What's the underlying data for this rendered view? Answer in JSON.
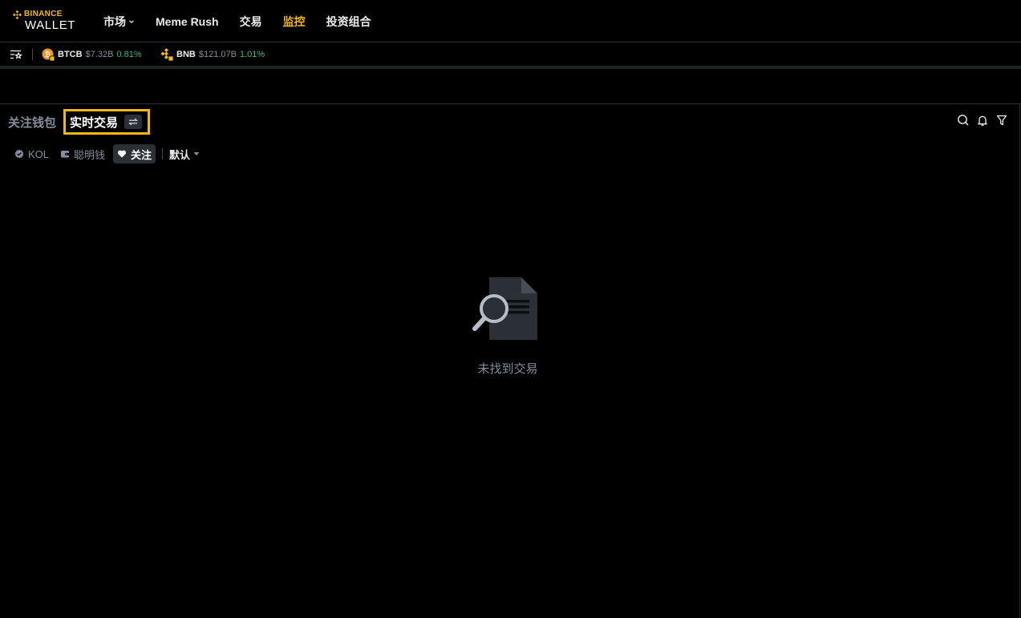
{
  "brand": {
    "name": "BINANCE",
    "product": "WALLET",
    "accent": "#f0b90b"
  },
  "nav": {
    "items": [
      {
        "label": "市场",
        "has_dropdown": true,
        "active": false
      },
      {
        "label": "Meme Rush",
        "active": false
      },
      {
        "label": "交易",
        "active": false
      },
      {
        "label": "监控",
        "active": true
      },
      {
        "label": "投资组合",
        "active": false
      }
    ]
  },
  "ticker": {
    "toggle_icon": "star-list-icon",
    "items": [
      {
        "symbol": "BTCB",
        "market_cap": "$7.32B",
        "change": "0.81%",
        "change_color": "#2ebd85",
        "icon": "btcb-coin-icon"
      },
      {
        "symbol": "BNB",
        "market_cap": "$121.07B",
        "change": "1.01%",
        "change_color": "#2ebd85",
        "icon": "bnb-coin-icon"
      }
    ]
  },
  "panel": {
    "tabs": [
      {
        "label": "关注钱包",
        "active": false
      },
      {
        "label": "实时交易",
        "active": true
      }
    ],
    "swap_icon": "swap-arrows-icon",
    "tools": [
      "search-icon",
      "bell-icon",
      "filter-icon"
    ],
    "filters": [
      {
        "label": "KOL",
        "icon": "verified-badge-icon",
        "active": false
      },
      {
        "label": "聪明钱",
        "icon": "wallet-icon",
        "active": false
      },
      {
        "label": "关注",
        "icon": "heart-icon",
        "active": true
      }
    ],
    "sort": {
      "label": "默认"
    },
    "empty_state": {
      "icon": "document-search-icon",
      "message": "未找到交易"
    }
  }
}
